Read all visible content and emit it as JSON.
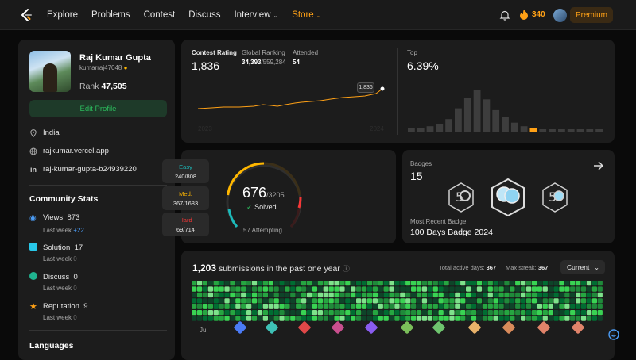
{
  "nav": {
    "links": [
      "Explore",
      "Problems",
      "Contest",
      "Discuss",
      "Interview",
      "Store"
    ],
    "coins": "340",
    "premium": "Premium",
    "accent": "#ffa116"
  },
  "profile": {
    "name": "Raj Kumar Gupta",
    "username": "kumarraj47048",
    "rank_label": "Rank",
    "rank": "47,505",
    "edit_button": "Edit Profile",
    "location": "India",
    "website": "rajkumar.vercel.app",
    "linkedin": "raj-kumar-gupta-b24939220"
  },
  "community": {
    "title": "Community Stats",
    "week_label": "Last week",
    "items": [
      {
        "label": "Views",
        "value": "873",
        "delta": "+22",
        "color": "#4b9cf5",
        "icon": "eye-icon"
      },
      {
        "label": "Solution",
        "value": "17",
        "delta": "0",
        "color": "#28c7e8",
        "icon": "check-icon"
      },
      {
        "label": "Discuss",
        "value": "0",
        "delta": "0",
        "color": "#1fb38f",
        "icon": "discuss-icon"
      },
      {
        "label": "Reputation",
        "value": "9",
        "delta": "0",
        "color": "#ffa116",
        "icon": "star-icon"
      }
    ]
  },
  "languages_title": "Languages",
  "contest": {
    "rating_label": "Contest Rating",
    "rating": "1,836",
    "global_label": "Global Ranking",
    "global_rank": "34,393",
    "global_total": "/559,284",
    "attended_label": "Attended",
    "attended": "54",
    "tooltip": "1,836",
    "year_start": "2023",
    "year_end": "2024",
    "top_label": "Top",
    "top_value": "6.39%",
    "histogram": [
      2,
      2,
      3,
      4,
      7,
      13,
      19,
      23,
      18,
      12,
      8,
      5,
      3,
      2,
      1,
      1,
      1,
      1,
      1,
      1,
      1
    ],
    "highlight_index": 13
  },
  "solved": {
    "count": "676",
    "total": "/3205",
    "label": "Solved",
    "attempting": "57 Attempting",
    "easy_label": "Easy",
    "easy": "240/808",
    "easy_color": "#1cbaba",
    "med_label": "Med.",
    "med": "367/1683",
    "med_color": "#ffb700",
    "hard_label": "Hard",
    "hard": "69/714",
    "hard_color": "#f63737"
  },
  "badges": {
    "label": "Badges",
    "count": "15",
    "recent_label": "Most Recent Badge",
    "recent": "100 Days Badge 2024"
  },
  "submissions": {
    "count": "1,203",
    "text": "submissions in the past one year",
    "active_label": "Total active days:",
    "active": "367",
    "streak_label": "Max streak:",
    "streak": "367",
    "select": "Current",
    "month": "Jul"
  }
}
